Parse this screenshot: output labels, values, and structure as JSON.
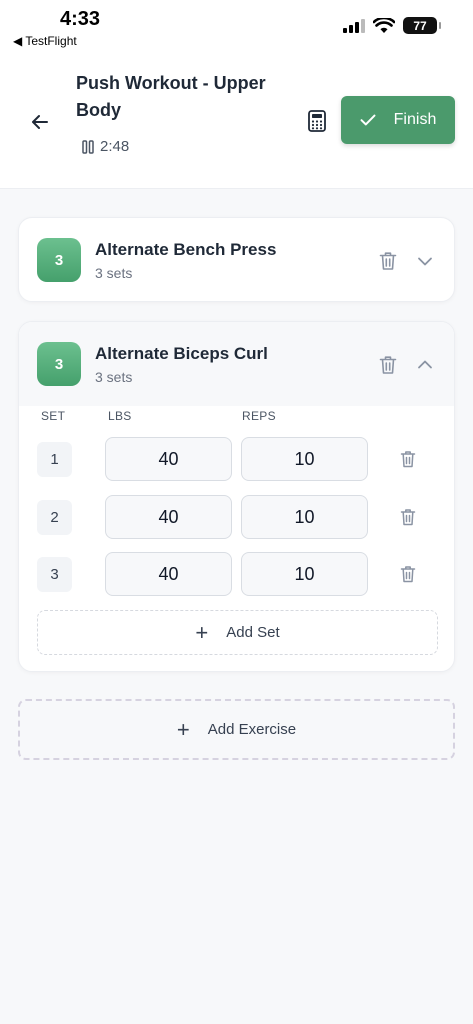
{
  "status_bar": {
    "time": "4:33",
    "back_app": "◀ TestFlight",
    "battery": "77"
  },
  "header": {
    "title": "Push Workout - Upper Body",
    "timer": "2:48",
    "finish_label": "Finish"
  },
  "exercises": [
    {
      "badge": "3",
      "name": "Alternate Bench Press",
      "sets_label": "3 sets",
      "expanded": false
    },
    {
      "badge": "3",
      "name": "Alternate Biceps Curl",
      "sets_label": "3 sets",
      "expanded": true,
      "columns": {
        "set": "SET",
        "weight": "LBS",
        "reps": "REPS"
      },
      "sets": [
        {
          "set": "1",
          "weight": "40",
          "reps": "10"
        },
        {
          "set": "2",
          "weight": "40",
          "reps": "10"
        },
        {
          "set": "3",
          "weight": "40",
          "reps": "10"
        }
      ],
      "add_set_label": "Add Set"
    }
  ],
  "add_exercise_label": "Add Exercise",
  "colors": {
    "accent": "#4b9a6c",
    "badge": "#5bb07f"
  }
}
